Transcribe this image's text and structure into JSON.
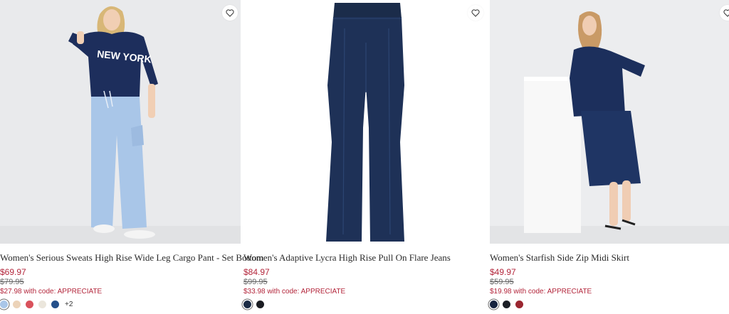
{
  "products": [
    {
      "title": "Women's Serious Sweats High Rise Wide Leg Cargo Pant - Set Bottom",
      "price": "$69.97",
      "original_price": "$79.95",
      "promo": "$27.98 with code: APPRECIATE",
      "swatch_colors": [
        "#a9c6e8",
        "#ecd3b9",
        "#d9525c",
        "#ebe6dc",
        "#24508a"
      ],
      "more_colors": "+2",
      "image_text": "NEW YORK"
    },
    {
      "title": "Women's Adaptive Lycra High Rise Pull On Flare Jeans",
      "price": "$84.97",
      "original_price": "$99.95",
      "promo": "$33.98 with code: APPRECIATE",
      "swatch_colors": [
        "#1b2b45",
        "#1a1c22"
      ]
    },
    {
      "title": "Women's Starfish Side Zip Midi Skirt",
      "price": "$49.97",
      "original_price": "$59.95",
      "promo": "$19.98 with code: APPRECIATE",
      "swatch_colors": [
        "#16233f",
        "#1c1f26",
        "#9a2630"
      ]
    }
  ],
  "colors": {
    "sale_red": "#b3263b",
    "navy": "#1d2e5c"
  },
  "icons": {
    "favorite": "heart-icon"
  }
}
